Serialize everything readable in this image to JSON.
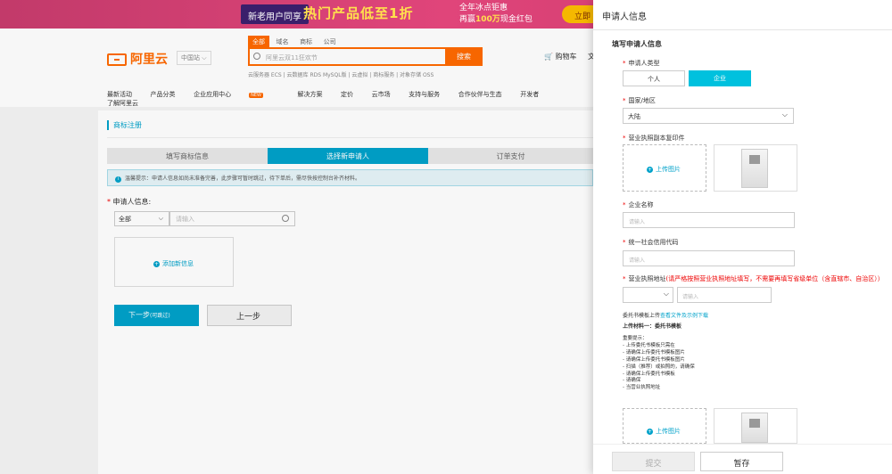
{
  "banner": {
    "prefix": "新老用户同享",
    "headline": "热门产品低至1折",
    "line1": "全年冰点钜惠",
    "line2a": "再赢",
    "line2b": "100万",
    "line2c": "现金红包",
    "button": "立即"
  },
  "header": {
    "logo": "阿里云",
    "site": "中国站 ⌵",
    "search_tabs": [
      "全部",
      "域名",
      "商标",
      "公司"
    ],
    "search_placeholder": "阿里云双11狂欢节",
    "search_button": "搜索",
    "hot": "云服务器 ECS | 云数据库 RDS MySQL版 | 云虚拟 | 商标服务 | 对象存储 OSS",
    "cart": "购物车",
    "cart_more": "文"
  },
  "nav": [
    "最新活动",
    "产品分类",
    "企业应用中心",
    "解决方案",
    "定价",
    "云市场",
    "支持与服务",
    "合作伙伴与生态",
    "开发者",
    "了解阿里云"
  ],
  "nav_badge": "NEW",
  "main": {
    "title": "商标注册",
    "steps": [
      "填写商标信息",
      "选择新申请人",
      "订单支付"
    ],
    "tip": "温馨提示：申请人信息如尚未准备完善，此步骤可暂时跳过，待下单后，需尽快按控制台补齐材料。",
    "applicant_label": "申请人信息:",
    "select_value": "全部",
    "input_placeholder": "请输入",
    "add_label": "添加新信息",
    "next_label": "下一步",
    "next_hint": "(可跳过)",
    "prev_label": "上一步"
  },
  "panel": {
    "title": "申请人信息",
    "section": "填写申请人信息",
    "type_label": "申请人类型",
    "types": [
      "个人",
      "企业"
    ],
    "country_label": "国家/地区",
    "country_value": "大陆",
    "license_label": "营业执照副本复印件",
    "upload_label": "上传图片",
    "company_label": "企业名称",
    "credit_label": "统一社会信用代码",
    "input_placeholder": "请输入",
    "address_label": "营业执照地址",
    "address_warn": "(请严格按照营业执照地址填写，不需要再填写省级单位（含直辖市、自治区））",
    "attorney_a": "委托书模板上传",
    "attorney_b": "查看文件及示例下载",
    "material_label": "上传材料一：委托书模板",
    "notes_title": "重要提示：",
    "notes": [
      "- 上传委托书模板只需在",
      "- 请确保上传委托书模板图片",
      "- 请确保上传委托书模板图片",
      "- 扫描（推荐）或拍照的，请确保",
      "- 请确保上传委托书模板",
      "- 请确保",
      "- 当营业执照地址"
    ],
    "submit": "提交",
    "save": "暂存"
  }
}
